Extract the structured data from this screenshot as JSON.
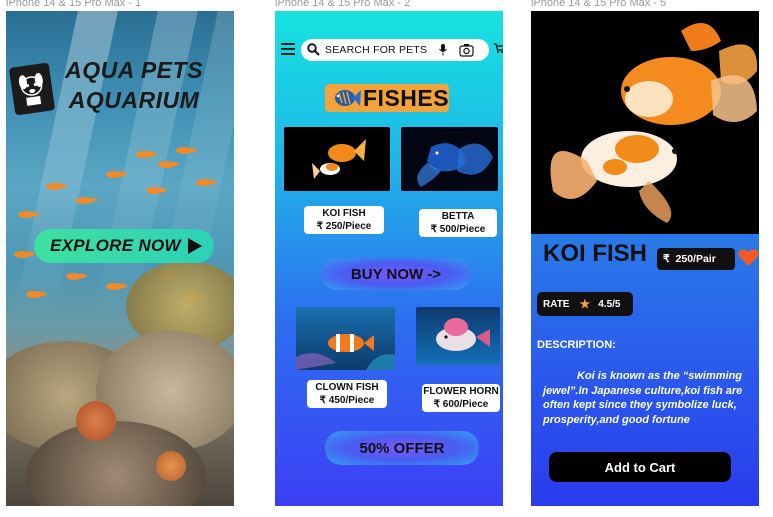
{
  "frames": [
    {
      "label": "iPhone 14 & 15 Pro Max - 1"
    },
    {
      "label": "iPhone 14 & 15 Pro Max - 2"
    },
    {
      "label": "iPhone 14 & 15 Pro Max - 5"
    }
  ],
  "splash": {
    "brand_line1": "AQUA PETS",
    "brand_line2": "AQUARIUM",
    "cta_label": "EXPLORE NOW"
  },
  "shop": {
    "search_placeholder": "SEARCH FOR PETS",
    "section_title": "FISHES",
    "products": [
      {
        "name": "KOI  FISH",
        "price": "250/Piece",
        "currency": "₹"
      },
      {
        "name": "BETTA",
        "price": "500/Piece",
        "currency": "₹"
      },
      {
        "name": "CLOWN FISH",
        "price": "450/Piece",
        "currency": "₹"
      },
      {
        "name": "FLOWER HORN",
        "price": "600/Piece",
        "currency": "₹"
      }
    ],
    "buy_now_label": "BUY NOW ->",
    "offer_label": "50% OFFER"
  },
  "detail": {
    "title": "KOI FISH",
    "currency": "₹",
    "price": "250/Pair",
    "rate_label": "RATE",
    "rating": "4.5/5",
    "description_heading": "DESCRIPTION:",
    "description": "Koi is known as the “swimming jewel”.In Japanese culture,koi fish are often kept since they symbolize luck, prosperity,and good fortune",
    "add_to_cart_label": "Add to Cart"
  },
  "colors": {
    "accent_orange": "#f4a23a",
    "heart": "#f15a24",
    "cta_green": "#3fe0a0"
  }
}
